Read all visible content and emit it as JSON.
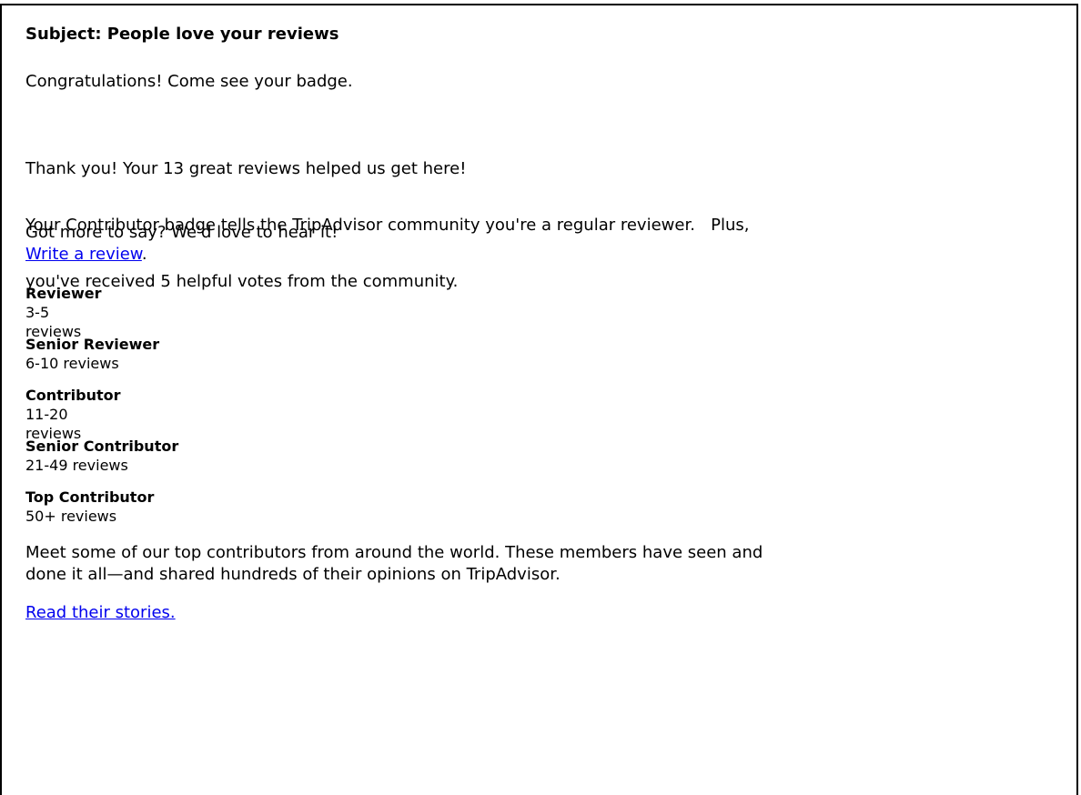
{
  "email": {
    "subject": "Subject: People love your reviews",
    "congrats": "Congratulations! Come see your badge.",
    "thanks_line1": "Thank you! Your 13 great reviews helped us get here!",
    "thanks_line2": "Your Contributor badge tells the TripAdvisor community you're a regular reviewer.   Plus,",
    "thanks_line3": "you've received 5 helpful votes from the community.",
    "more_line": "Got more to say? We'd love to hear it!",
    "write_link": "Write a review",
    "write_period": ".",
    "badges": [
      {
        "name": "Reviewer",
        "range": "3-5 reviews"
      },
      {
        "name": "Senior Reviewer",
        "range": "6-10 reviews"
      },
      {
        "name": "Contributor",
        "range": "11-20 reviews"
      },
      {
        "name": "Senior Contributor",
        "range": "21-49 reviews"
      },
      {
        "name": "Top Contributor",
        "range": "50+ reviews"
      }
    ],
    "meet_line1": "Meet some of our top contributors from around the world. These members have seen and",
    "meet_line2": "done it all—and shared hundreds of their opinions on TripAdvisor.",
    "stories_link": "Read their stories."
  },
  "colors": {
    "link": "#0000ee",
    "text": "#000000",
    "border": "#000000"
  }
}
